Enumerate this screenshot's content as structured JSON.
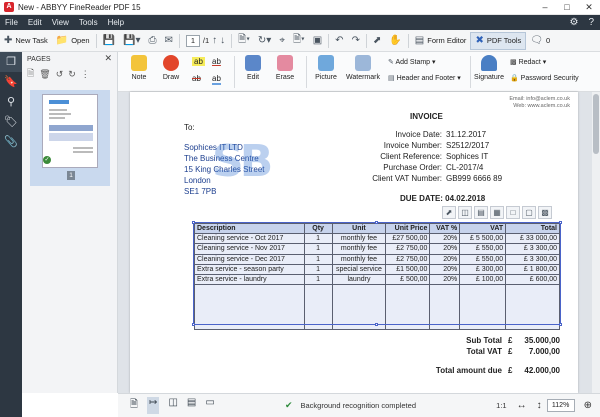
{
  "window": {
    "title": "New - ABBYY FineReader PDF 15"
  },
  "menu": {
    "items": [
      "File",
      "Edit",
      "View",
      "Tools",
      "Help"
    ]
  },
  "toolbar": {
    "new_task": "New Task",
    "open": "Open",
    "page_current": "1",
    "page_total": "/1",
    "form_editor": "Form Editor",
    "pdf_tools": "PDF Tools",
    "comments_count": "0"
  },
  "pages_panel": {
    "title": "PAGES",
    "thumb_number": "1"
  },
  "ribbon": {
    "note": "Note",
    "draw": "Draw",
    "edit": "Edit",
    "erase": "Erase",
    "picture": "Picture",
    "watermark": "Watermark",
    "add_stamp": "Add Stamp",
    "header_footer": "Header and Footer",
    "signature": "Signature",
    "redact": "Redact",
    "password_security": "Password Security"
  },
  "document": {
    "contact_email": "Email: info@aclem.co.uk",
    "contact_web": "Web: www.aclem.co.uk",
    "invoice_title": "INVOICE",
    "to_label": "To:",
    "address": [
      "Sophices IT LTD",
      "The Business Centre",
      "15 King Charles Street",
      "London",
      "SE1 7PB"
    ],
    "meta_labels": [
      "Invoice Date:",
      "Invoice Number:",
      "Client Reference:",
      "Purchase Order:",
      "Client VAT Number:"
    ],
    "meta_values": [
      "31.12.2017",
      "S2512/2017",
      "Sophices IT",
      "CL-2017/4",
      "GB999 6666 89"
    ],
    "due_date": "DUE DATE: 04.02.2018",
    "table": {
      "headers": [
        "Description",
        "Qty",
        "Unit",
        "Unit Price",
        "VAT %",
        "VAT",
        "Total"
      ],
      "rows": [
        [
          "Cleaning service - Oct 2017",
          "1",
          "monthly fee",
          "£27 500,00",
          "20%",
          "£  5 500,00",
          "£  33 000,00"
        ],
        [
          "Cleaning service - Nov 2017",
          "1",
          "monthly fee",
          "£2 750,00",
          "20%",
          "£  550,00",
          "£  3 300,00"
        ],
        [
          "Cleaning service - Dec 2017",
          "1",
          "monthly fee",
          "£2 750,00",
          "20%",
          "£  550,00",
          "£  3 300,00"
        ],
        [
          "Extra service - season party",
          "1",
          "special service",
          "£1 500,00",
          "20%",
          "£  300,00",
          "£  1 800,00"
        ],
        [
          "Extra service - laundry",
          "1",
          "laundry",
          "£  500,00",
          "20%",
          "£  100,00",
          "£  600,00"
        ]
      ]
    },
    "subtotal_label": "Sub Total",
    "subtotal_currency": "£",
    "subtotal_value": "35.000,00",
    "totalvat_label": "Total VAT",
    "totalvat_currency": "£",
    "totalvat_value": "7.000,00",
    "amountdue_label": "Total amount due",
    "amountdue_currency": "£",
    "amountdue_value": "42.000,00"
  },
  "status": {
    "recognition": "Background recognition completed",
    "ratio": "1:1",
    "zoom": "112%"
  },
  "colors": {
    "menubar_bg": "#2d3742",
    "selection_frame": "#4a63c9",
    "table_header": "#c7d3ec",
    "watermark": "#3c78d2"
  }
}
